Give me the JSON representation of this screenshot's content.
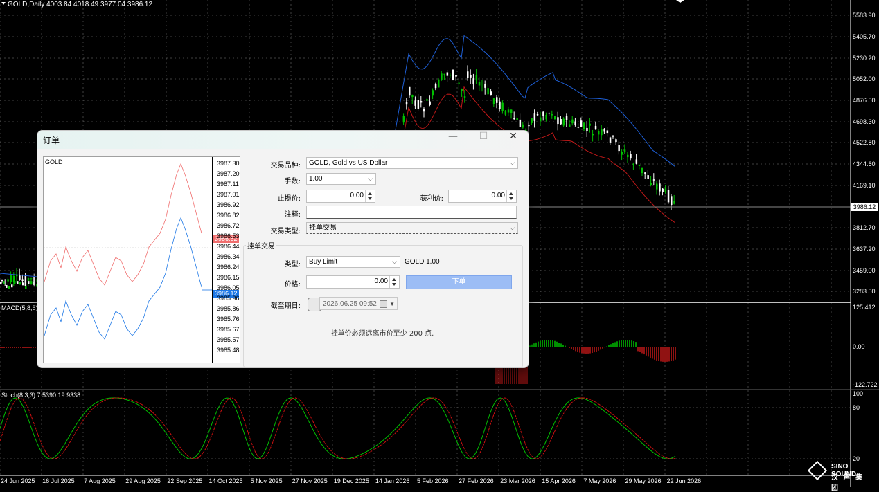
{
  "chart": {
    "header": "GOLD,Daily  4003.84 4018.49 3977.04 3986.12",
    "current_price": "3986.12",
    "price_axis": [
      "5583.90",
      "5405.70",
      "5230.20",
      "5052.00",
      "4876.50",
      "4698.30",
      "4522.80",
      "4344.60",
      "4169.10",
      "3812.70",
      "3637.20",
      "3459.00",
      "3283.50"
    ],
    "macd_label": "MACD(5,8,5)",
    "macd_axis": [
      "125.412",
      "0.00",
      "-122.722"
    ],
    "stoch_label": "Stoch(8,3,3) 7.5390 19.9338",
    "stoch_axis": [
      "100",
      "80",
      "20"
    ],
    "dates": [
      "24 Jun 2025",
      "16 Jul 2025",
      "7 Aug 2025",
      "29 Aug 2025",
      "22 Sep 2025",
      "14 Oct 2025",
      "5 Nov 2025",
      "27 Nov 2025",
      "19 Dec 2025",
      "14 Jan 2026",
      "5 Feb 2026",
      "27 Feb 2026",
      "23 Mar 2026",
      "15 Apr 2026",
      "7 May 2026",
      "29 May 2026",
      "22 Jun 2026"
    ],
    "colors": {
      "bull": "#00c000",
      "bear": "#ffffff",
      "upper": "#1e5fd6",
      "lower": "#c01818",
      "macd_pos": "#00c000",
      "macd_neg": "#c01818",
      "stoch_main": "#00c000",
      "stoch_signal": "#d01010"
    }
  },
  "logo": {
    "line1": "SINO SOUND",
    "line2": "汉 声 集 团"
  },
  "dialog": {
    "title": "订单",
    "minimize": "—",
    "maximize": "☐",
    "close": "✕",
    "tick_chart": {
      "symbol": "GOLD",
      "axis": [
        "3987.30",
        "3987.20",
        "3987.11",
        "3987.01",
        "3986.92",
        "3986.82",
        "3986.72",
        "3986.53",
        "3986.44",
        "3986.34",
        "3986.24",
        "3986.15",
        "3986.05",
        "3985.96",
        "3985.86",
        "3985.76",
        "3985.67",
        "3985.57",
        "3985.48"
      ],
      "ask": "3986.62",
      "bid": "3986.12"
    },
    "symbol_label": "交易品种:",
    "symbol_value": "GOLD, Gold vs US Dollar",
    "volume_label": "手数:",
    "volume_value": "1.00",
    "sl_label": "止损价:",
    "sl_value": "0.00",
    "tp_label": "获利价:",
    "tp_value": "0.00",
    "comment_label": "注释:",
    "comment_value": "",
    "type_label": "交易类型:",
    "type_value": "挂单交易",
    "pending": {
      "title": "挂单交易",
      "order_type_label": "类型:",
      "order_type_value": "Buy Limit",
      "summary": "GOLD 1.00",
      "price_label": "价格:",
      "price_value": "0.00",
      "place_button": "下单",
      "expiry_label": "截至期日:",
      "expiry_value": "2026.06.25 09:52",
      "note": "挂单价必须远离市价至少 200 点."
    }
  }
}
